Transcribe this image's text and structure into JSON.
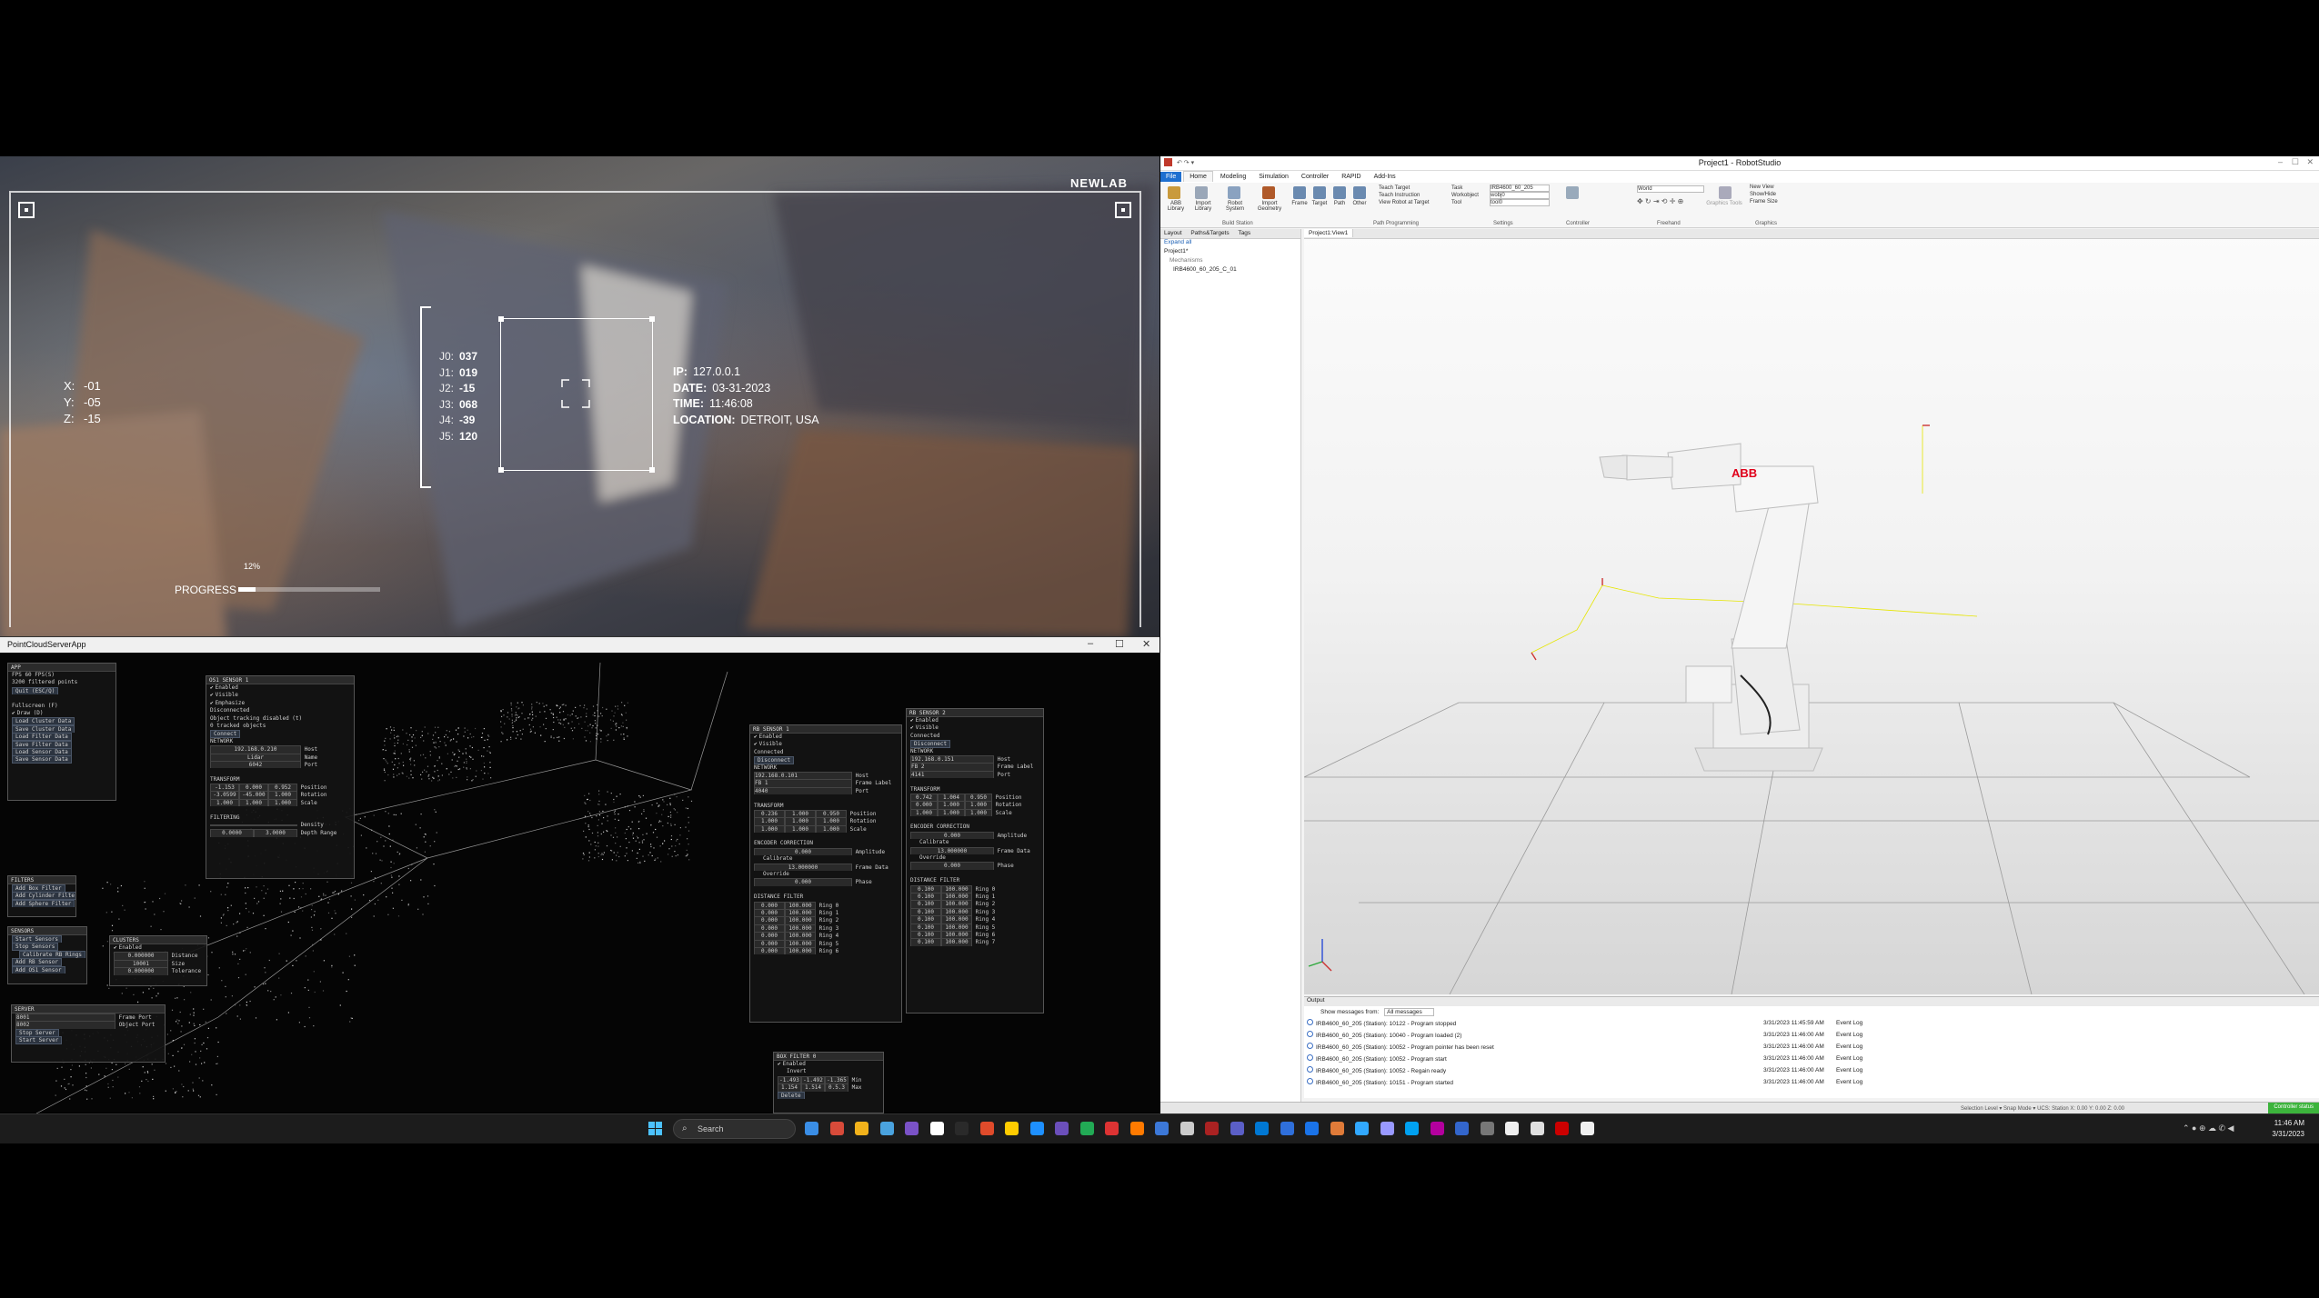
{
  "hud": {
    "brand": "NEWLAB",
    "position": [
      {
        "axis": "X:",
        "value": "-01"
      },
      {
        "axis": "Y:",
        "value": "-05"
      },
      {
        "axis": "Z:",
        "value": "-15"
      }
    ],
    "joints": [
      {
        "label": "J0:",
        "value": "037"
      },
      {
        "label": "J1:",
        "value": "019"
      },
      {
        "label": "J2:",
        "value": "-15"
      },
      {
        "label": "J3:",
        "value": "068"
      },
      {
        "label": "J4:",
        "value": "-39"
      },
      {
        "label": "J5:",
        "value": "120"
      }
    ],
    "info": [
      {
        "label": "IP:",
        "value": "127.0.0.1"
      },
      {
        "label": "DATE:",
        "value": "03-31-2023"
      },
      {
        "label": "TIME:",
        "value": "11:46:08"
      },
      {
        "label": "LOCATION:",
        "value": "DETROIT, USA"
      }
    ],
    "progress_label": "PROGRESS",
    "progress_pct_text": "12%",
    "progress_value": 0.12
  },
  "pointcloud": {
    "window_title": "PointCloudServerApp",
    "app_panel": {
      "title": "APP",
      "lines": [
        "FPS 60 FPS(S)",
        "3200 filtered points",
        "Quit (ESC/Q)"
      ],
      "toggles": [
        "Fullscreen (F)",
        "Draw (D)"
      ],
      "buttons": [
        "Load Cluster Data",
        "Save Cluster Data",
        "Load Filter Data",
        "Save Filter Data",
        "Load Sensor Data",
        "Save Sensor Data"
      ]
    },
    "ouster_panel": {
      "title": "OS1 SENSOR 1",
      "checks": [
        "Enabled",
        "Visible",
        "Emphasize"
      ],
      "lines": [
        "Disconnected",
        "Object tracking disabled (t)",
        "0 tracked objects",
        "Connect",
        "NETWORK"
      ],
      "ip": "192.168.0.210",
      "ip_label": "Host",
      "name": "Lidar",
      "name_label": "Name",
      "port": "6042",
      "port_label": "Port",
      "transform_title": "TRANSFORM",
      "transform": [
        {
          "label": "Position",
          "vals": [
            "-1.153",
            "0.000",
            "0.952"
          ]
        },
        {
          "label": "Rotation",
          "vals": [
            "-3.0599",
            "-45.000",
            "1.000"
          ]
        },
        {
          "label": "Scale",
          "vals": [
            "1.000",
            "1.000",
            "1.000"
          ]
        }
      ],
      "filtering_title": "FILTERING",
      "filter_rows": [
        {
          "label": "Density",
          "vals": [
            "",
            ""
          ]
        },
        {
          "label": "Depth Range",
          "vals": [
            "0.0000",
            "3.0000"
          ]
        }
      ]
    },
    "filters_panel": {
      "title": "FILTERS",
      "buttons": [
        "Add Box Filter",
        "Add Cylinder Filter",
        "Add Sphere Filter"
      ]
    },
    "sensors_panel": {
      "title": "SENSORS",
      "buttons": [
        "Start Sensors",
        "Stop Sensors",
        "Calibrate RB Rings",
        "Add RB Sensor",
        "Add OS1 Sensor"
      ]
    },
    "clusters_panel": {
      "title": "CLUSTERS",
      "rows": [
        {
          "label": "",
          "value": "Enabled"
        },
        {
          "label": "Distance",
          "value": "0.000000"
        },
        {
          "label": "Size",
          "value": "10001"
        },
        {
          "label": "Tolerance",
          "value": "0.000000"
        }
      ]
    },
    "server_panel": {
      "title": "SERVER",
      "rows": [
        {
          "label": "Frame Port",
          "value": "8001"
        },
        {
          "label": "Object Port",
          "value": "8002"
        }
      ],
      "buttons": [
        "Stop Server",
        "Start Server"
      ]
    },
    "rb_sensor_1": {
      "title": "RB SENSOR 1",
      "checks": [
        "Enabled",
        "Visible"
      ],
      "lines": [
        "Connected",
        "Disconnect",
        "NETWORK"
      ],
      "fields": [
        {
          "label": "Host",
          "value": "192.168.0.101"
        },
        {
          "label": "Frame Label",
          "value": "FB 1"
        },
        {
          "label": "Port",
          "value": "4040"
        }
      ],
      "transform_title": "TRANSFORM",
      "transform": [
        {
          "label": "Position",
          "vals": [
            "0.236",
            "1.000",
            "0.950"
          ]
        },
        {
          "label": "Rotation",
          "vals": [
            "1.000",
            "1.000",
            "1.000"
          ]
        },
        {
          "label": "Scale",
          "vals": [
            "1.000",
            "1.000",
            "1.000"
          ]
        }
      ],
      "encoder_title": "ENCODER CORRECTION",
      "encoder": [
        {
          "label": "Amplitude",
          "value": "0.000"
        },
        {
          "label": "Calibrate",
          "value": ""
        },
        {
          "label": "Frame Data",
          "value": "13.000000"
        },
        {
          "label": "Override",
          "value": ""
        },
        {
          "label": "Phase",
          "value": "0.000"
        }
      ],
      "distance_title": "DISTANCE FILTER",
      "rings": [
        {
          "min": "0.000",
          "max": "100.000",
          "label": "Ring 0"
        },
        {
          "min": "0.000",
          "max": "100.000",
          "label": "Ring 1"
        },
        {
          "min": "0.000",
          "max": "100.000",
          "label": "Ring 2"
        },
        {
          "min": "0.000",
          "max": "100.000",
          "label": "Ring 3"
        },
        {
          "min": "0.000",
          "max": "100.000",
          "label": "Ring 4"
        },
        {
          "min": "0.000",
          "max": "100.000",
          "label": "Ring 5"
        },
        {
          "min": "0.000",
          "max": "100.000",
          "label": "Ring 6"
        }
      ]
    },
    "rb_sensor_2": {
      "title": "RB SENSOR 2",
      "checks": [
        "Enabled",
        "Visible"
      ],
      "lines": [
        "Connected",
        "Disconnect",
        "NETWORK"
      ],
      "fields": [
        {
          "label": "Host",
          "value": "192.168.0.151"
        },
        {
          "label": "Frame Label",
          "value": "FB 2"
        },
        {
          "label": "Port",
          "value": "4141"
        }
      ],
      "transform_title": "TRANSFORM",
      "transform": [
        {
          "label": "Position",
          "vals": [
            "0.742",
            "1.004",
            "0.950"
          ]
        },
        {
          "label": "Rotation",
          "vals": [
            "0.000",
            "1.000",
            "1.000"
          ]
        },
        {
          "label": "Scale",
          "vals": [
            "1.000",
            "1.000",
            "1.000"
          ]
        }
      ],
      "encoder_title": "ENCODER CORRECTION",
      "encoder": [
        {
          "label": "Amplitude",
          "value": "0.000"
        },
        {
          "label": "Calibrate",
          "value": ""
        },
        {
          "label": "Frame Data",
          "value": "13.000000"
        },
        {
          "label": "Override",
          "value": ""
        },
        {
          "label": "Phase",
          "value": "0.000"
        }
      ],
      "distance_title": "DISTANCE FILTER",
      "rings": [
        {
          "min": "0.100",
          "max": "100.000",
          "label": "Ring 0"
        },
        {
          "min": "0.100",
          "max": "100.000",
          "label": "Ring 1"
        },
        {
          "min": "0.100",
          "max": "100.000",
          "label": "Ring 2"
        },
        {
          "min": "0.100",
          "max": "100.000",
          "label": "Ring 3"
        },
        {
          "min": "0.100",
          "max": "100.000",
          "label": "Ring 4"
        },
        {
          "min": "0.100",
          "max": "100.000",
          "label": "Ring 5"
        },
        {
          "min": "0.100",
          "max": "100.000",
          "label": "Ring 6"
        },
        {
          "min": "0.100",
          "max": "100.000",
          "label": "Ring 7"
        }
      ]
    },
    "box_filter": {
      "title": "BOX FILTER 0",
      "checks": [
        "Enabled",
        "Invert"
      ],
      "rows": [
        {
          "label": "Min",
          "vals": [
            "-1.493",
            "-1.492",
            "-1.365"
          ]
        },
        {
          "label": "Max",
          "vals": [
            "1.154",
            "1.514",
            "0.5.3"
          ]
        },
        {
          "label": "",
          "vals": [
            "Delete"
          ]
        }
      ]
    }
  },
  "robotstudio": {
    "title": "Project1 - RobotStudio",
    "tabs": [
      "File",
      "Home",
      "Modeling",
      "Simulation",
      "Controller",
      "RAPID",
      "Add-Ins"
    ],
    "ribbon": {
      "buttons": [
        "ABB Library",
        "Import Library",
        "Robot System",
        "Import Geometry",
        "Frame",
        "Target",
        "Path",
        "Other"
      ],
      "path_items": [
        "Teach Target",
        "Teach Instruction",
        "View Robot at Target"
      ],
      "settings_labels": [
        "Task",
        "Workobject",
        "Tool"
      ],
      "settings_values": [
        "IRB4600_60_205",
        "wobj0",
        "tool0"
      ],
      "groups": [
        "Build Station",
        "Path Programming",
        "Settings",
        "Controller",
        "Freehand",
        "Graphics"
      ],
      "graphics_items": [
        "New View",
        "Show/Hide",
        "Frame Size"
      ],
      "freehand_value": "World"
    },
    "left_tabs": [
      "Layout",
      "Paths&Targets",
      "Tags"
    ],
    "tree": [
      "Expand all",
      "Project1*",
      "Mechanisms",
      "IRB4600_60_205_C_01"
    ],
    "view_tab": "Project1:View1",
    "robot_brand": "ABB",
    "output": {
      "title": "Output",
      "filter_label": "Show messages from:",
      "filter_value": "All messages",
      "columns": [
        "",
        "Time",
        "Category"
      ],
      "rows": [
        {
          "msg": "IRB4600_60_205 (Station): 10122 - Program stopped",
          "time": "3/31/2023 11:45:59 AM",
          "cat": "Event Log"
        },
        {
          "msg": "IRB4600_60_205 (Station): 10040 - Program loaded (2)",
          "time": "3/31/2023 11:46:00 AM",
          "cat": "Event Log"
        },
        {
          "msg": "IRB4600_60_205 (Station): 10052 - Program pointer has been reset",
          "time": "3/31/2023 11:46:00 AM",
          "cat": "Event Log"
        },
        {
          "msg": "IRB4600_60_205 (Station): 10052 - Program start",
          "time": "3/31/2023 11:46:00 AM",
          "cat": "Event Log"
        },
        {
          "msg": "IRB4600_60_205 (Station): 10052 - Regain ready",
          "time": "3/31/2023 11:46:00 AM",
          "cat": "Event Log"
        },
        {
          "msg": "IRB4600_60_205 (Station): 10151 - Program started",
          "time": "3/31/2023 11:46:00 AM",
          "cat": "Event Log"
        }
      ]
    },
    "status_left": "Selection Level ▾   Snap Mode ▾   UCS: Station   X: 0.00  Y: 0.00  Z: 0.00",
    "controller_status": "Controller status"
  },
  "taskbar": {
    "search_placeholder": "Search",
    "time": "11:46 AM",
    "date": "3/31/2023",
    "icon_colors": [
      "#3a8ee6",
      "#d84b3a",
      "#f2b21b",
      "#4aa3df",
      "#7a52c7",
      "#ffffff",
      "#2a2a2a",
      "#e04b2b",
      "#ffcc00",
      "#1e90ff",
      "#6b4fbb",
      "#22aa55",
      "#dd3333",
      "#ff7a00",
      "#3c78d8",
      "#ccc",
      "#aa2222",
      "#5b5fc7",
      "#0078d4",
      "#2f6fdb",
      "#1a73e8",
      "#e07b39",
      "#31a8ff",
      "#9999ff",
      "#00a1f1",
      "#b4009e",
      "#3366cc",
      "#777",
      "#eee",
      "#e0e0e0",
      "#cc0000",
      "#f0f0f0"
    ]
  }
}
